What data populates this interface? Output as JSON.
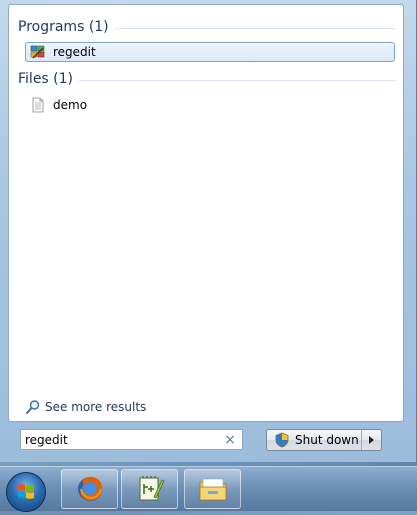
{
  "results": {
    "programs": {
      "header": "Programs (1)",
      "items": [
        {
          "label": "regedit",
          "icon": "registry-editor-icon",
          "selected": true
        }
      ]
    },
    "files": {
      "header": "Files (1)",
      "items": [
        {
          "label": "demo",
          "icon": "text-document-icon",
          "selected": false
        }
      ]
    },
    "see_more_label": "See more results"
  },
  "search": {
    "value": "regedit",
    "clear_icon": "×"
  },
  "shutdown": {
    "label": "Shut down"
  },
  "taskbar": {
    "apps": [
      "firefox-icon",
      "notepad-plus-plus-icon",
      "file-explorer-icon"
    ]
  }
}
